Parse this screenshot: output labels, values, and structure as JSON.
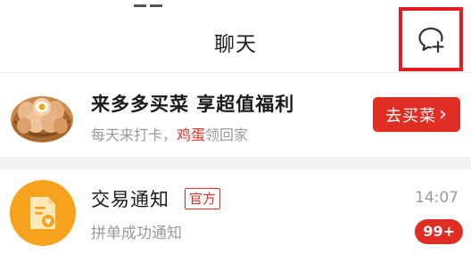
{
  "header": {
    "title": "聊天"
  },
  "icons": {
    "new_chat": "chat-bubble-plus-icon",
    "promo_image": "egg-basket-icon",
    "trade_avatar": "document-yen-icon"
  },
  "promo": {
    "title": "来多多买菜 享超值福利",
    "subtitle_pre": "每天来打卡，",
    "subtitle_highlight": "鸡蛋",
    "subtitle_post": "领回家",
    "cta_label": "去买菜",
    "cta_chevron": "›"
  },
  "conversations": [
    {
      "name": "交易通知",
      "tag": "官方",
      "preview": "拼单成功通知",
      "time": "14:07",
      "unread": "99+"
    }
  ],
  "colors": {
    "brand_red": "#e02e24",
    "highlight_box": "#e51c23",
    "avatar_orange": "#f6a21c",
    "muted_text": "#9a9a9a",
    "section_gap": "#f3f3f3"
  }
}
